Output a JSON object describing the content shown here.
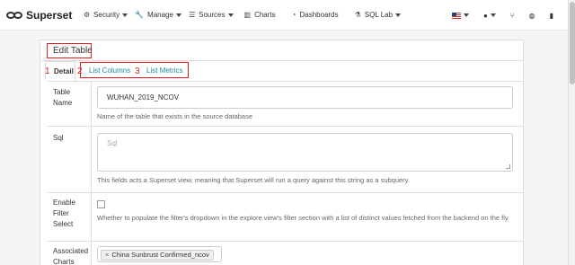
{
  "brand": {
    "name": "Superset"
  },
  "nav": {
    "items": [
      {
        "label": "Security",
        "icon": "gear-icon",
        "dropdown": true
      },
      {
        "label": "Manage",
        "icon": "wrench-icon",
        "dropdown": true
      },
      {
        "label": "Sources",
        "icon": "database-icon",
        "dropdown": true
      },
      {
        "label": "Charts",
        "icon": "bar-chart-icon",
        "dropdown": false
      },
      {
        "label": "Dashboards",
        "icon": "dashboard-icon",
        "dropdown": false
      },
      {
        "label": "SQL Lab",
        "icon": "flask-icon",
        "dropdown": true
      }
    ],
    "right": [
      "flag-icon",
      "user-icon",
      "version-icon",
      "github-icon",
      "book-icon"
    ]
  },
  "panel": {
    "title": "Edit Table"
  },
  "tabs": [
    {
      "num": "1",
      "label": "Detail"
    },
    {
      "num": "2",
      "label": "List Columns"
    },
    {
      "num": "3",
      "label": "List Metrics"
    }
  ],
  "form": {
    "table_name": {
      "label": "Table Name",
      "value": "WUHAN_2019_NCOV",
      "help": "Name of the table that exists in the source database"
    },
    "sql": {
      "label": "Sql",
      "placeholder": "Sql",
      "help": "This fields acts a Superset view, meaning that Superset will run a query against this string as a subquery."
    },
    "filter_select": {
      "label": "Enable Filter Select",
      "checked": false,
      "help": "Whether to populate the filter's dropdown in the explore view's filter section with a list of distinct values fetched from the backend on the fly"
    },
    "associated_charts": {
      "label": "Associated Charts",
      "tags": [
        "China Sunbrust Confirmed_ncov"
      ]
    }
  },
  "colors": {
    "annotation": "#e02020",
    "link": "#1a8a9e"
  }
}
